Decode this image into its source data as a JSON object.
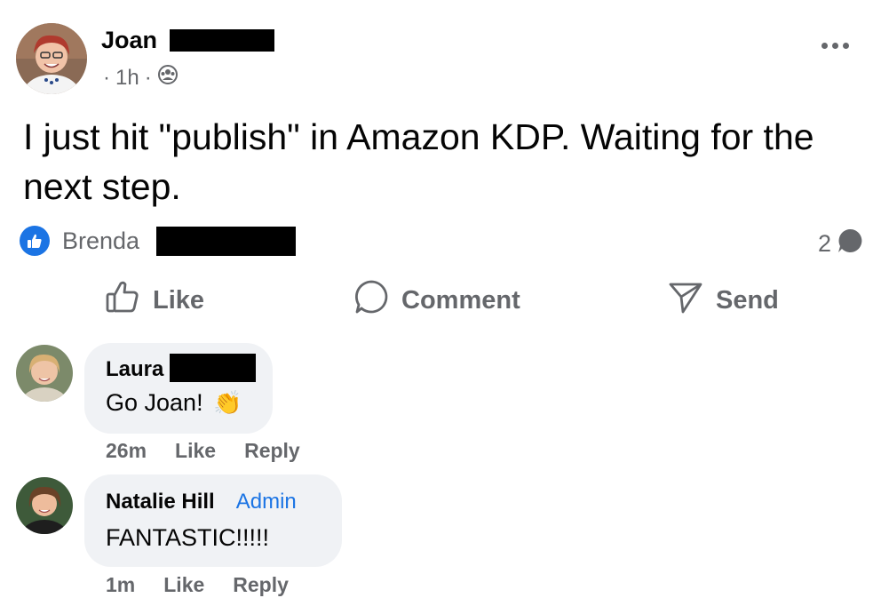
{
  "post": {
    "author": "Joan",
    "time": "1h",
    "audience_icon": "group-icon",
    "text": "I just hit \"publish\" in Amazon KDP. Waiting for the next step.",
    "reactor": "Brenda",
    "comment_count": "2"
  },
  "actions": {
    "like": "Like",
    "comment": "Comment",
    "send": "Send"
  },
  "comments": [
    {
      "author": "Laura",
      "text": "Go Joan!",
      "emoji": "👏",
      "time": "26m",
      "like": "Like",
      "reply": "Reply"
    },
    {
      "author": "Natalie Hill",
      "badge": "Admin",
      "text": "FANTASTIC!!!!!",
      "time": "1m",
      "like": "Like",
      "reply": "Reply"
    }
  ],
  "colors": {
    "accent": "#1b74e4",
    "secondary_text": "#65676b",
    "bubble": "#f0f2f5"
  }
}
